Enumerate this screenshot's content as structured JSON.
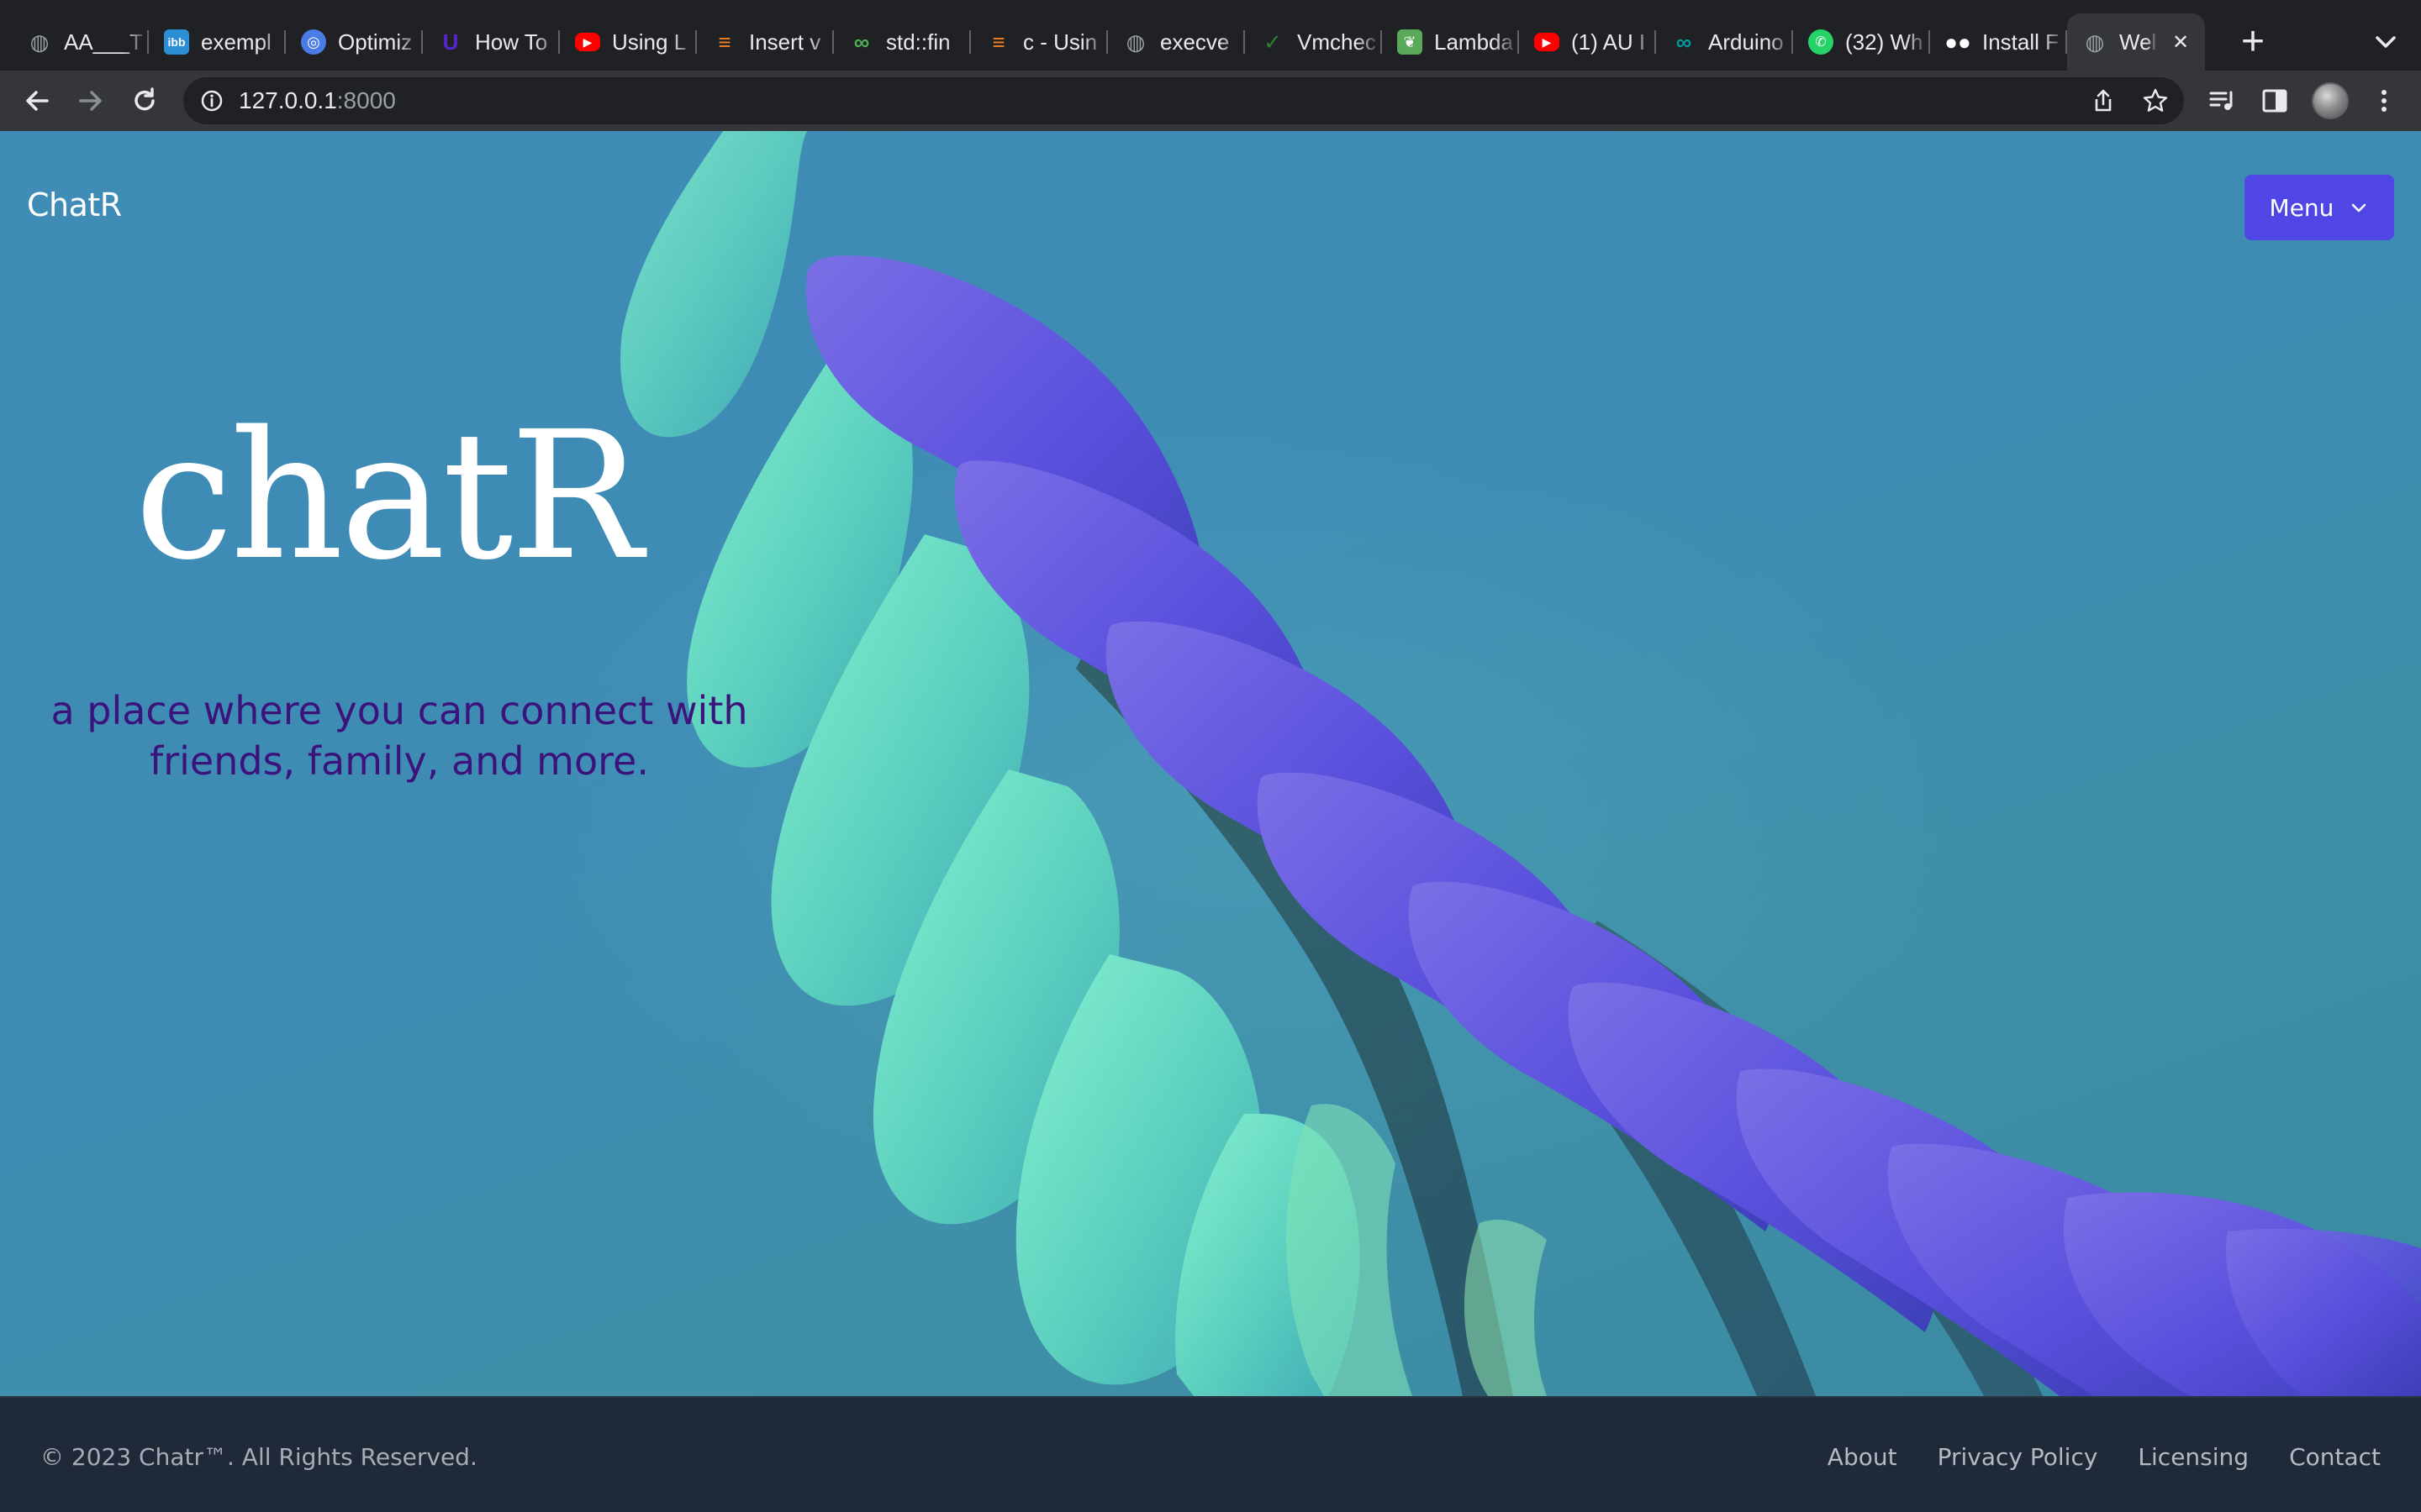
{
  "browser": {
    "tabs": [
      {
        "label": "AA___T",
        "icon": "globe-icon",
        "color": "#9aa0a6"
      },
      {
        "label": "exempl",
        "icon": "ibb-icon",
        "color": "#2b8fd6"
      },
      {
        "label": "Optimiz",
        "icon": "optimizer-icon",
        "color": "#4a7be6"
      },
      {
        "label": "How To",
        "icon": "udemy-icon",
        "color": "#5624d0"
      },
      {
        "label": "Using L",
        "icon": "youtube-icon",
        "color": "#ff0000"
      },
      {
        "label": "Insert v",
        "icon": "stackoverflow-icon",
        "color": "#f48024"
      },
      {
        "label": "std::fin",
        "icon": "cppreference-icon",
        "color": "#4caf50"
      },
      {
        "label": "c - Usin",
        "icon": "stackoverflow-icon",
        "color": "#f48024"
      },
      {
        "label": "execve",
        "icon": "globe-icon",
        "color": "#9aa0a6"
      },
      {
        "label": "Vmchec",
        "icon": "checkmark-icon",
        "color": "#2e7d32"
      },
      {
        "label": "Lambda",
        "icon": "leaf-icon",
        "color": "#5aa85a"
      },
      {
        "label": "(1) AU I",
        "icon": "youtube-icon",
        "color": "#ff0000"
      },
      {
        "label": "Arduino",
        "icon": "arduino-icon",
        "color": "#00979d"
      },
      {
        "label": "(32) Wh",
        "icon": "whatsapp-icon",
        "color": "#25d366"
      },
      {
        "label": "Install F",
        "icon": "medium-icon",
        "color": "#ffffff"
      },
      {
        "label": "Wel",
        "icon": "globe-icon",
        "color": "#9aa0a6",
        "active": true
      }
    ],
    "address": {
      "host": "127.0.0.1",
      "port": ":8000"
    }
  },
  "page": {
    "brand": "ChatR",
    "menu_label": "Menu",
    "hero_title": "chatR",
    "hero_subtitle": "a place where you can connect with friends, family, and more.",
    "footer": {
      "copyright": "© 2023 Chatr™. All Rights Reserved.",
      "links": [
        "About",
        "Privacy Policy",
        "Licensing",
        "Contact"
      ]
    }
  },
  "colors": {
    "hero_bg": "#3f8db6",
    "menu_button": "#4f46e5",
    "subtitle": "#3b137a",
    "footer_bg": "#1f2937",
    "wave_purple": "#6a5ae0",
    "wave_green": "#6fe0c0"
  }
}
